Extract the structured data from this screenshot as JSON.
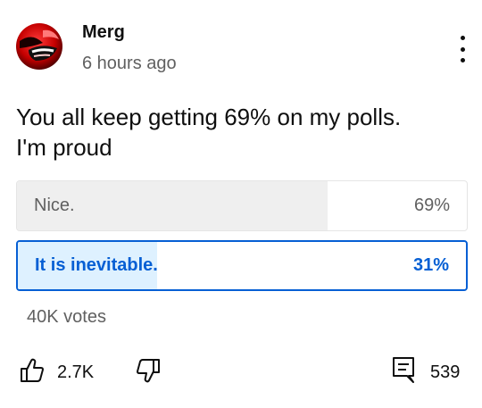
{
  "post": {
    "author": "Merg",
    "time": "6 hours ago",
    "text_lines": [
      "You all keep getting 69% on my polls.",
      "I'm proud"
    ]
  },
  "poll": {
    "options": [
      {
        "label": "Nice.",
        "percent_label": "69%",
        "percent": 69,
        "selected": false
      },
      {
        "label": "It is inevitable.",
        "percent_label": "31%",
        "percent": 31,
        "selected": true
      }
    ],
    "votes": "40K votes"
  },
  "actions": {
    "likes": "2.7K",
    "comments": "539"
  },
  "colors": {
    "accent": "#065fd4",
    "selected_fill": "#def1ff",
    "bar_fill": "#efefef",
    "secondary_text": "#606060"
  },
  "icons": [
    "avatar",
    "more-vert-icon",
    "thumbs-up-icon",
    "thumbs-down-icon",
    "comment-icon"
  ]
}
